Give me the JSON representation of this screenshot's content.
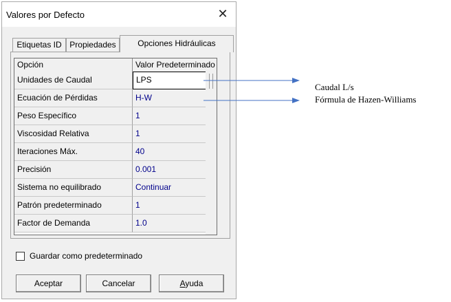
{
  "dialog": {
    "title": "Valores por Defecto",
    "close_label": "✕"
  },
  "tabs": [
    {
      "label": "Etiquetas ID",
      "active": false
    },
    {
      "label": "Propiedades",
      "active": false
    },
    {
      "label": "Opciones Hidráulicas",
      "active": true
    }
  ],
  "grid": {
    "headers": [
      "Opción",
      "Valor Predeterminado"
    ],
    "rows": [
      {
        "option": "Unidades de Caudal",
        "value": "LPS"
      },
      {
        "option": "Ecuación de Pérdidas",
        "value": "H-W"
      },
      {
        "option": "Peso Específico",
        "value": "1"
      },
      {
        "option": "Viscosidad Relativa",
        "value": "1"
      },
      {
        "option": "Iteraciones Máx.",
        "value": "40"
      },
      {
        "option": "Precisión",
        "value": "0.001"
      },
      {
        "option": "Sistema no equilibrado",
        "value": "Continuar"
      },
      {
        "option": "Patrón predeterminado",
        "value": "1"
      },
      {
        "option": "Factor de Demanda",
        "value": "1.0"
      }
    ]
  },
  "save_default": {
    "label": "Guardar como predeterminado",
    "checked": false
  },
  "buttons": {
    "ok": "Aceptar",
    "cancel": "Cancelar",
    "help_first": "A",
    "help_rest": "yuda"
  },
  "annotations": {
    "flow_units": "Caudal L/s",
    "headloss": "Fórmula de Hazen-Williams",
    "arrow_color": "#4472c4"
  }
}
